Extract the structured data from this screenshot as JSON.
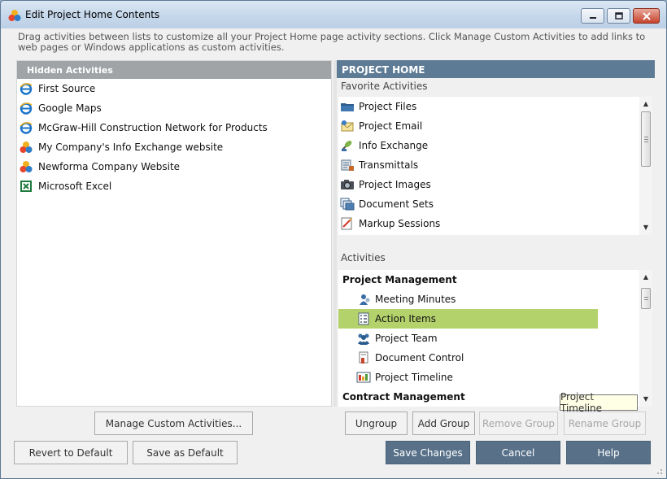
{
  "window": {
    "title": "Edit Project Home Contents",
    "description": "Drag activities between lists to customize all your Project Home page activity sections.  Click Manage Custom Activities to add links to web pages or Windows applications as custom activities."
  },
  "hidden_activities": {
    "header": "Hidden Activities",
    "items": [
      {
        "label": "First Source",
        "icon": "ie-icon"
      },
      {
        "label": "Google Maps",
        "icon": "ie-icon"
      },
      {
        "label": "McGraw-Hill Construction Network for Products",
        "icon": "ie-icon"
      },
      {
        "label": "My Company's Info Exchange website",
        "icon": "newforma-icon"
      },
      {
        "label": "Newforma Company Website",
        "icon": "newforma-icon"
      },
      {
        "label": "Microsoft Excel",
        "icon": "excel-icon"
      }
    ]
  },
  "project_home": {
    "header": "PROJECT HOME",
    "favorites_label": "Favorite Activities",
    "favorites": [
      {
        "label": "Project Files",
        "icon": "folder-icon"
      },
      {
        "label": "Project Email",
        "icon": "email-icon"
      },
      {
        "label": "Info Exchange",
        "icon": "satellite-icon"
      },
      {
        "label": "Transmittals",
        "icon": "transmittal-icon"
      },
      {
        "label": "Project Images",
        "icon": "camera-icon"
      },
      {
        "label": "Document Sets",
        "icon": "document-sets-icon"
      },
      {
        "label": "Markup Sessions",
        "icon": "markup-icon"
      }
    ],
    "activities_label": "Activities",
    "groups": [
      {
        "name": "Project Management",
        "items": [
          {
            "label": "Meeting Minutes",
            "icon": "meeting-icon",
            "selected": false
          },
          {
            "label": "Action Items",
            "icon": "checklist-icon",
            "selected": true
          },
          {
            "label": "Project Team",
            "icon": "team-icon",
            "selected": false
          },
          {
            "label": "Document Control",
            "icon": "document-control-icon",
            "selected": false
          },
          {
            "label": "Project Timeline",
            "icon": "timeline-icon",
            "selected": false
          }
        ]
      },
      {
        "name": "Contract Management",
        "items": []
      }
    ],
    "tooltip": "Project Timeline"
  },
  "buttons": {
    "manage_custom": "Manage Custom Activities...",
    "ungroup": "Ungroup",
    "add_group": "Add Group",
    "remove_group": "Remove Group",
    "rename_group": "Rename Group",
    "revert_default": "Revert to Default",
    "save_as_default": "Save as Default",
    "save_changes": "Save Changes",
    "cancel": "Cancel",
    "help": "Help"
  },
  "colors": {
    "selected_row": "#b4d26c",
    "project_header": "#5e7b95",
    "hidden_header": "#a0a4a6",
    "dark_button": "#587189"
  }
}
